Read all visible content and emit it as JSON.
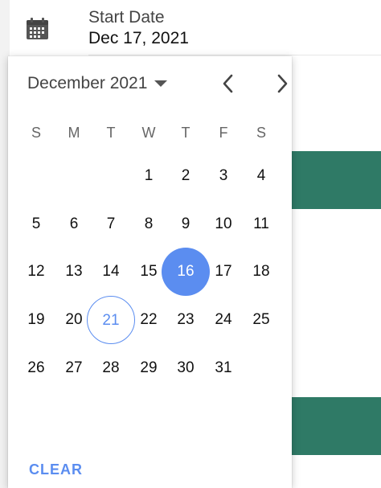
{
  "date_field": {
    "label": "Start Date",
    "value": "Dec 17, 2021",
    "icon": "calendar-icon"
  },
  "picker": {
    "month_label": "December 2021",
    "weekdays": [
      "S",
      "M",
      "T",
      "W",
      "T",
      "F",
      "S"
    ],
    "weeks": [
      [
        "",
        "",
        "",
        "1",
        "2",
        "3",
        "4"
      ],
      [
        "5",
        "6",
        "7",
        "8",
        "9",
        "10",
        "11"
      ],
      [
        "12",
        "13",
        "14",
        "15",
        "16",
        "17",
        "18"
      ],
      [
        "19",
        "20",
        "21",
        "22",
        "23",
        "24",
        "25"
      ],
      [
        "26",
        "27",
        "28",
        "29",
        "30",
        "31",
        ""
      ]
    ],
    "selected_day": "16",
    "today_day": "21",
    "clear_label": "CLEAR"
  },
  "colors": {
    "accent": "#5b8df0",
    "green_band": "#2f7a66"
  }
}
